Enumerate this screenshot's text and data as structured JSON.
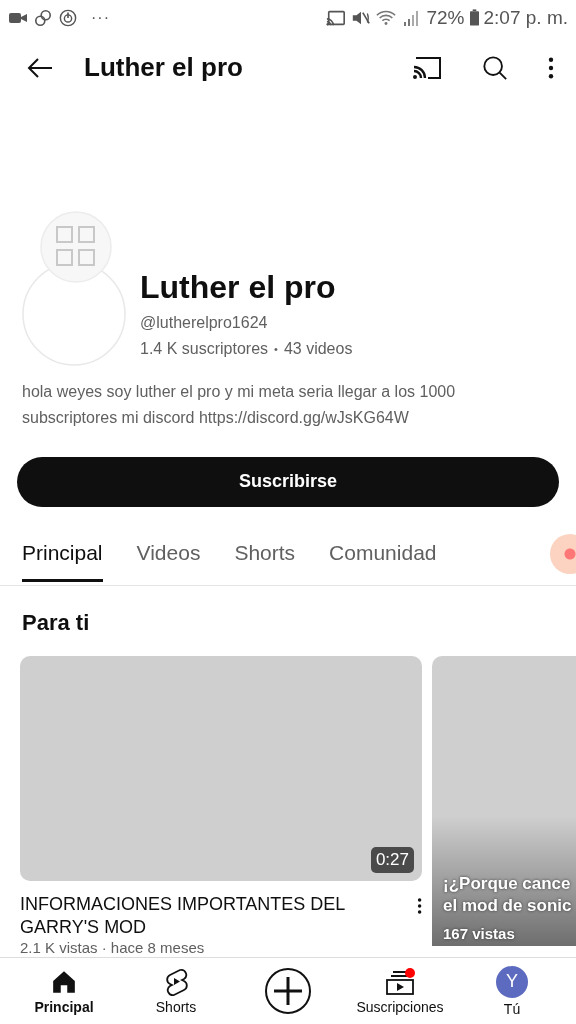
{
  "status_bar": {
    "more": "···",
    "battery": "72%",
    "time": "2:07 p. m."
  },
  "app_bar": {
    "title": "Luther el pro"
  },
  "channel": {
    "name": "Luther el pro",
    "handle": "@lutherelpro1624",
    "subscribers": "1.4 K suscriptores",
    "separator": "•",
    "videos": "43 videos",
    "description": "hola weyes soy luther el pro y mi meta seria llegar a los 1000 subscriptores mi discord https://discord.gg/wJsKG64W"
  },
  "subscribe_button": "Suscribirse",
  "tabs": [
    {
      "label": "Principal",
      "selected": true
    },
    {
      "label": "Videos",
      "selected": false
    },
    {
      "label": "Shorts",
      "selected": false
    },
    {
      "label": "Comunidad",
      "selected": false
    }
  ],
  "section_title": "Para ti",
  "videos": [
    {
      "kind": "video",
      "title": "INFORMACIONES IMPORTANTES DEL GARRY'S MOD",
      "duration": "0:27",
      "meta": "2.1 K vistas · hace 8 meses"
    },
    {
      "kind": "short",
      "title_lines": [
        "¡¿Porque cance",
        "el mod de sonic"
      ],
      "views": "167 vistas"
    }
  ],
  "nav": [
    {
      "kind": "home",
      "label": "Principal",
      "selected": true
    },
    {
      "kind": "shorts",
      "label": "Shorts",
      "selected": false
    },
    {
      "kind": "create"
    },
    {
      "kind": "subscriptions",
      "label": "Suscripciones",
      "selected": false,
      "badge": true
    },
    {
      "kind": "avatar",
      "label": "Tú",
      "initial": "Y",
      "color": "#5c6bc0",
      "selected": false
    }
  ]
}
